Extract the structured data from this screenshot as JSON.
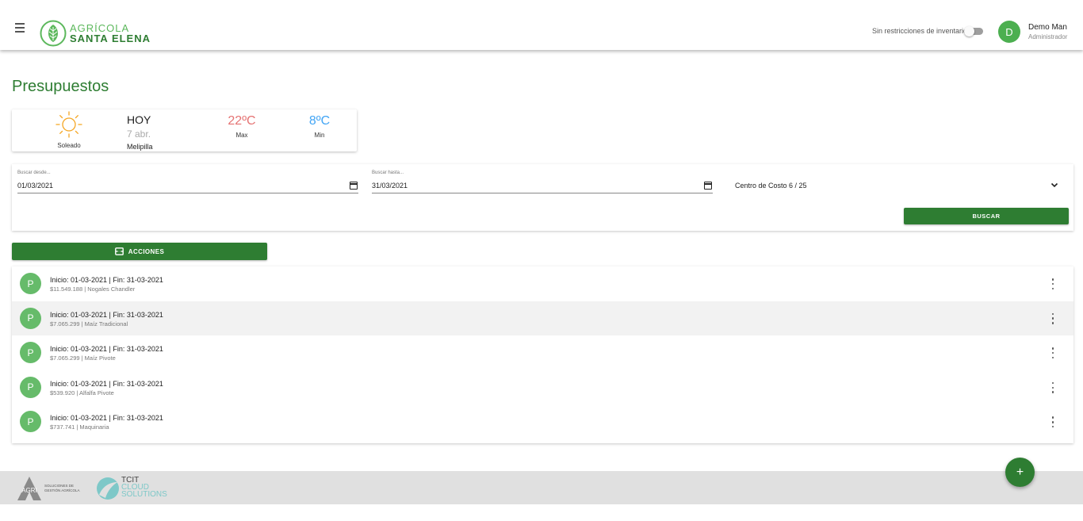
{
  "header": {
    "logo_line1": "AGRÍCOLA",
    "logo_line2": "SANTA ELENA",
    "inventory_toggle_label": "Sin restricciones de inventario",
    "inventory_toggle_on": false,
    "user_initial": "D",
    "user_name": "Demo Man",
    "user_role": "Administrador"
  },
  "page": {
    "title": "Presupuestos"
  },
  "weather": {
    "icon": "sun-icon",
    "condition": "Soleado",
    "day_label": "HOY",
    "date": "7 abr.",
    "location": "Melipilla",
    "max_temp": "22ºC",
    "max_label": "Max",
    "min_temp": "8ºC",
    "min_label": "Min"
  },
  "filters": {
    "from_label": "Buscar desde...",
    "from_value": "01/03/2021",
    "to_label": "Buscar hasta...",
    "to_value": "31/03/2021",
    "cost_center": "Centro de Costo 6 / 25",
    "search_button": "BUSCAR"
  },
  "actions": {
    "label": "ACCIONES",
    "icon": "inbox-icon"
  },
  "budgets": [
    {
      "initial": "P",
      "title": "Inicio: 01-03-2021 | Fin: 31-03-2021",
      "subtitle": "$11.549.188 | Nogales Chandler"
    },
    {
      "initial": "P",
      "title": "Inicio: 01-03-2021 | Fin: 31-03-2021",
      "subtitle": "$7.065.299 | Maíz Tradicional"
    },
    {
      "initial": "P",
      "title": "Inicio: 01-03-2021 | Fin: 31-03-2021",
      "subtitle": "$7.065.299 | Maíz Pivote"
    },
    {
      "initial": "P",
      "title": "Inicio: 01-03-2021 | Fin: 31-03-2021",
      "subtitle": "$539.920 | Alfalfa Pivote"
    },
    {
      "initial": "P",
      "title": "Inicio: 01-03-2021 | Fin: 31-03-2021",
      "subtitle": "$737.741 | Maquinaria"
    }
  ],
  "footer": {
    "agri_mark": "AGRI",
    "agri_line1": "SOLUCIONES DE",
    "agri_line2": "GESTIÓN AGRÍCOLA",
    "tcit_line1": "TCIT",
    "tcit_line2": "CLOUD",
    "tcit_line3": "SOLUTIONS"
  },
  "fab": {
    "label": "+"
  },
  "colors": {
    "primary": "#2e7d32",
    "avatar": "#66bb6a",
    "max_temp": "#e57373",
    "min_temp": "#42a5f5"
  }
}
